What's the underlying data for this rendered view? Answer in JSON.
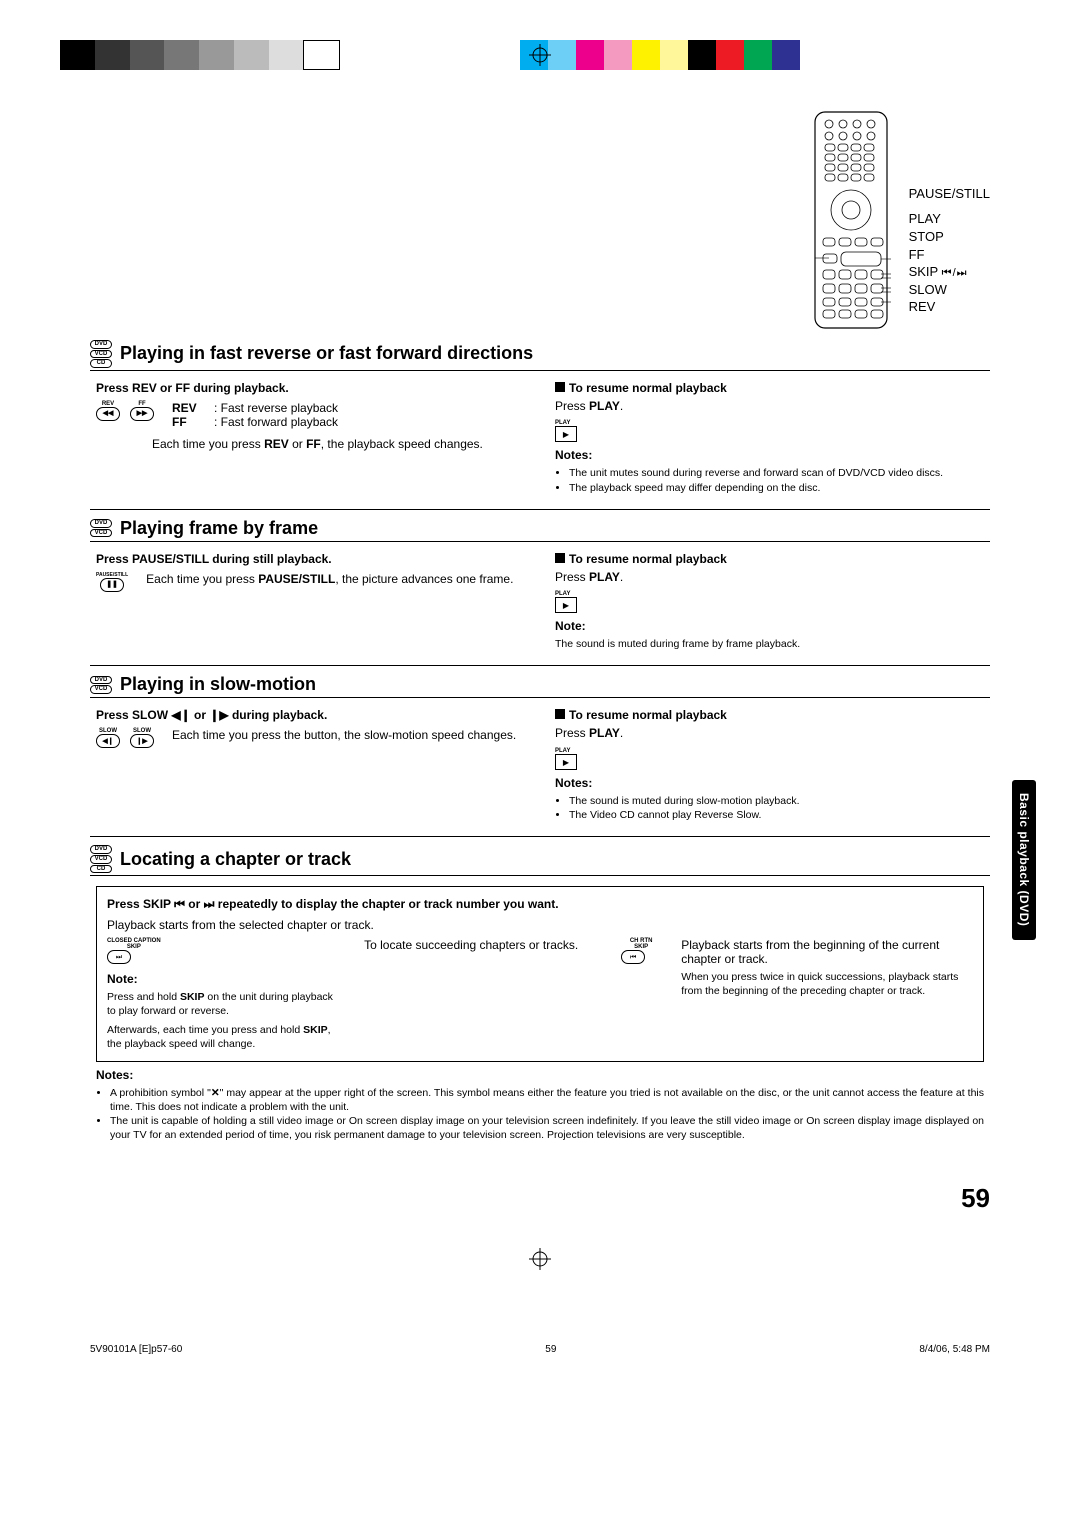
{
  "remote_labels": {
    "pause": "PAUSE/STILL",
    "play": "PLAY",
    "stop": "STOP",
    "ff": "FF",
    "skip": "SKIP",
    "slow": "SLOW",
    "rev": "REV"
  },
  "section1": {
    "badges": [
      "DVD",
      "VCD",
      "CD"
    ],
    "title": "Playing in fast reverse or fast forward directions",
    "left": {
      "step": "Press REV or FF during playback.",
      "btn1": "REV",
      "btn2": "FF",
      "def1k": "REV",
      "def1v": ": Fast reverse playback",
      "def2k": "FF",
      "def2v": ":   Fast forward playback",
      "para1a": "Each time you press ",
      "para1b": "REV",
      "para1c": " or ",
      "para1d": "FF",
      "para1e": ", the playback speed changes."
    },
    "right": {
      "resume_h": "To resume normal playback",
      "resume_t1": "Press ",
      "resume_t2": "PLAY",
      "resume_t3": ".",
      "play_lbl": "PLAY",
      "notes_h": "Notes:",
      "note1": "The unit mutes sound during reverse and forward scan of DVD/VCD video discs.",
      "note2": "The playback speed may differ depending on the disc."
    }
  },
  "section2": {
    "badges": [
      "DVD",
      "VCD"
    ],
    "title": "Playing frame by frame",
    "left": {
      "step": "Press PAUSE/STILL during still playback.",
      "btn": "PAUSE/STILL",
      "para1a": "Each time you press ",
      "para1b": "PAUSE/STILL",
      "para1c": ", the picture advances one frame."
    },
    "right": {
      "resume_h": "To resume normal playback",
      "resume_t1": "Press ",
      "resume_t2": "PLAY",
      "resume_t3": ".",
      "play_lbl": "PLAY",
      "notes_h": "Note:",
      "note1": "The sound is muted during frame by frame playback."
    }
  },
  "section3": {
    "badges": [
      "DVD",
      "VCD"
    ],
    "title": "Playing in slow-motion",
    "left": {
      "step_a": "Press SLOW ",
      "step_b": " or ",
      "step_c": " during playback.",
      "btn1": "SLOW",
      "btn2": "SLOW",
      "para": "Each time you press the button, the slow-motion speed changes."
    },
    "right": {
      "resume_h": "To resume normal playback",
      "resume_t1": "Press ",
      "resume_t2": "PLAY",
      "resume_t3": ".",
      "play_lbl": "PLAY",
      "notes_h": "Notes:",
      "note1": "The sound is muted during slow-motion playback.",
      "note2": "The Video CD cannot play Reverse Slow."
    }
  },
  "section4": {
    "badges": [
      "DVD",
      "VCD",
      "CD"
    ],
    "title": "Locating a chapter or track",
    "box_title_a": "Press SKIP ",
    "box_title_b": " or ",
    "box_title_c": " repeatedly to display the chapter or track number you want.",
    "line1": "Playback starts from the selected chapter or track.",
    "btn1a": "CLOSED CAPTION",
    "btn1b": "SKIP",
    "col2": "To locate succeeding chapters or tracks.",
    "btn2a": "CH RTN",
    "btn2b": "SKIP",
    "col3a": "Playback starts from the beginning of the current chapter or track.",
    "col3b": "When you press twice in quick successions, playback starts from the beginning of the preceding chapter or track.",
    "note_h": "Note:",
    "note1a": "Press and hold ",
    "note1b": "SKIP",
    "note1c": " on the unit during playback to play forward or reverse.",
    "note2a": "Afterwards, each time you press and hold ",
    "note2b": "SKIP",
    "note2c": ", the playback speed will change."
  },
  "bottom_notes": {
    "h": "Notes:",
    "n1a": "A prohibition symbol \"",
    "n1b": "\" may appear at the upper right of the screen. This symbol means either the feature you tried is not available on the disc, or the unit cannot access the feature at this time. This does not indicate a problem with the unit.",
    "n2": "The unit is capable of holding a still video image or On screen display image on your television screen indefinitely. If you leave the still video image or On screen display image displayed on your TV for an extended period of time, you risk permanent damage to your television screen. Projection televisions are very susceptible."
  },
  "side_tab": "Basic playback (DVD)",
  "page_number": "59",
  "footer": {
    "left": "5V90101A [E]p57-60",
    "center": "59",
    "right": "8/4/06, 5:48 PM"
  }
}
